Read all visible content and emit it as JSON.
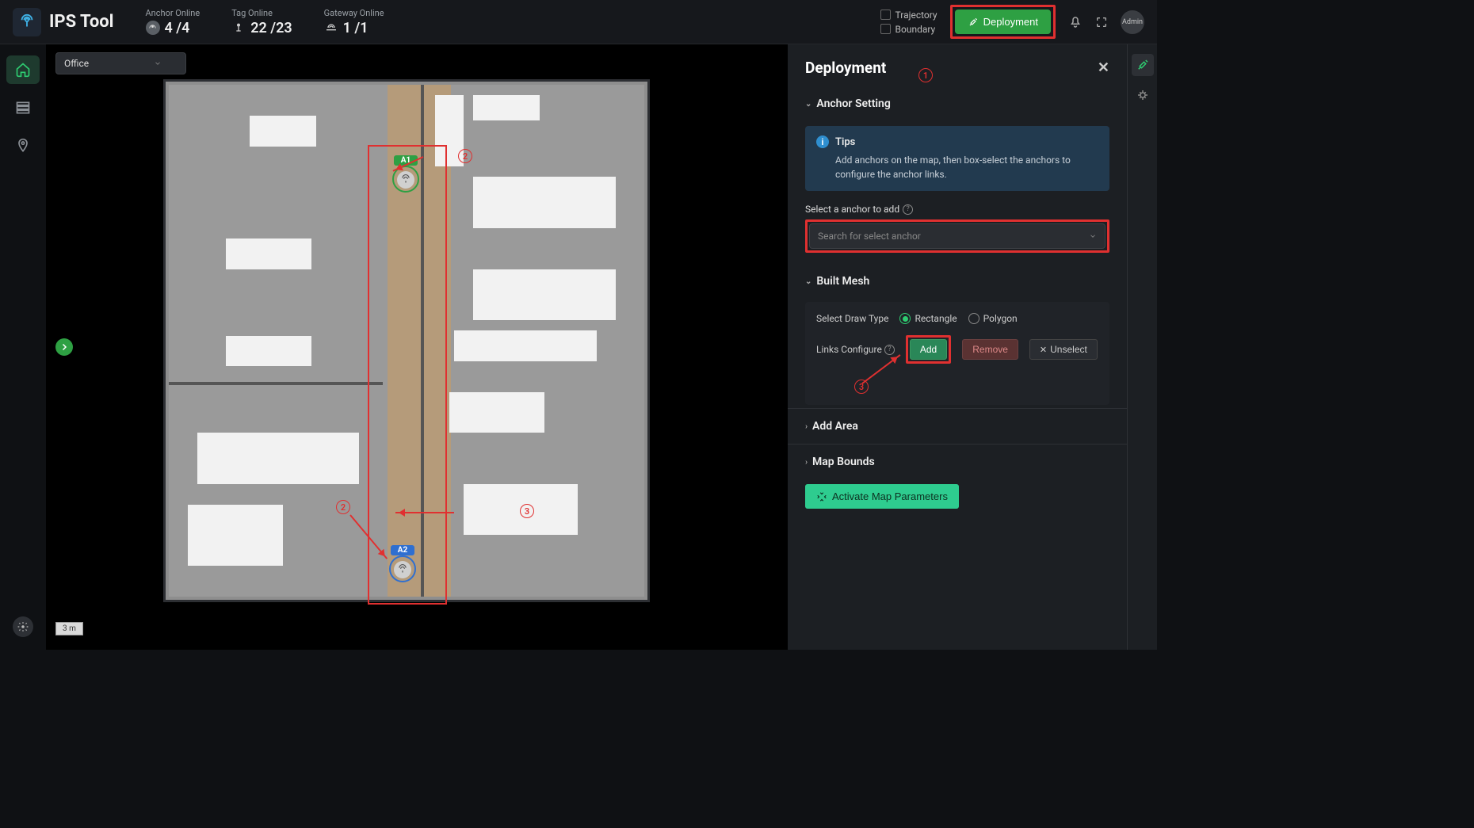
{
  "app": {
    "title": "IPS Tool"
  },
  "header": {
    "stats": {
      "anchor": {
        "label": "Anchor Online",
        "value": "4 /4"
      },
      "tag": {
        "label": "Tag Online",
        "value": "22 /23"
      },
      "gateway": {
        "label": "Gateway Online",
        "value": "1 /1"
      }
    },
    "checks": {
      "trajectory": "Trajectory",
      "boundary": "Boundary"
    },
    "deploy_label": "Deployment",
    "user": "Admin"
  },
  "map": {
    "selected_area": "Office",
    "scale_label": "3 m",
    "anchors": {
      "a1": "A1",
      "a2": "A2"
    }
  },
  "panel": {
    "title": "Deployment",
    "sections": {
      "anchor_setting": "Anchor Setting",
      "built_mesh": "Built Mesh",
      "add_area": "Add Area",
      "map_bounds": "Map Bounds"
    },
    "tips": {
      "title": "Tips",
      "text": "Add anchors on the map, then box-select the anchors to configure the anchor links."
    },
    "select_anchor_label": "Select a anchor to add",
    "select_anchor_placeholder": "Search for select anchor",
    "draw_type_label": "Select Draw Type",
    "draw_rect": "Rectangle",
    "draw_poly": "Polygon",
    "links_configure_label": "Links Configure",
    "btn_add": "Add",
    "btn_remove": "Remove",
    "btn_unselect": "Unselect",
    "btn_activate": "Activate Map Parameters"
  },
  "callouts": {
    "c1": "1",
    "c2": "2",
    "c3": "3"
  }
}
